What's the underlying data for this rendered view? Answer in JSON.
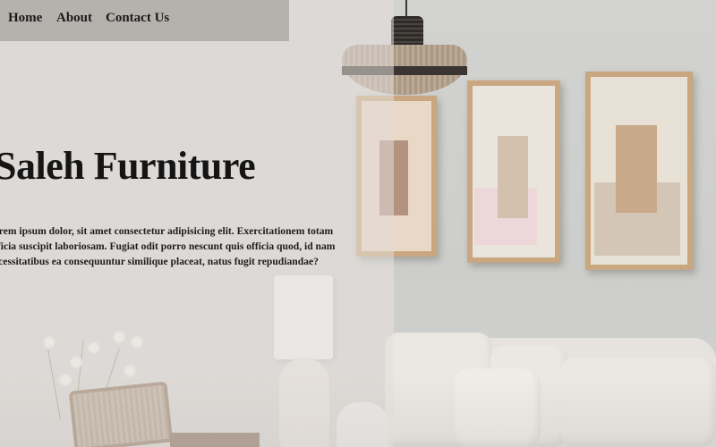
{
  "nav": {
    "items": [
      {
        "label": "Home"
      },
      {
        "label": "About"
      },
      {
        "label": "Contact Us"
      }
    ]
  },
  "hero": {
    "title": "Saleh Furniture",
    "paragraph_lines": [
      "orem ipsum dolor, sit amet consectetur adipisicing elit. Exercitationem totam",
      "fficia suscipit laboriosam. Fugiat odit porro nescunt quis officia quod, id nam",
      "ecessitatibus ea consequuntur similique placeat, natus fugit repudiandae?"
    ]
  },
  "colors": {
    "text": "#151515",
    "nav_background": "#96918c",
    "overlay": "#e2dcd8",
    "wall": "#cfd0cd",
    "frame_wood": "#c9a780"
  }
}
